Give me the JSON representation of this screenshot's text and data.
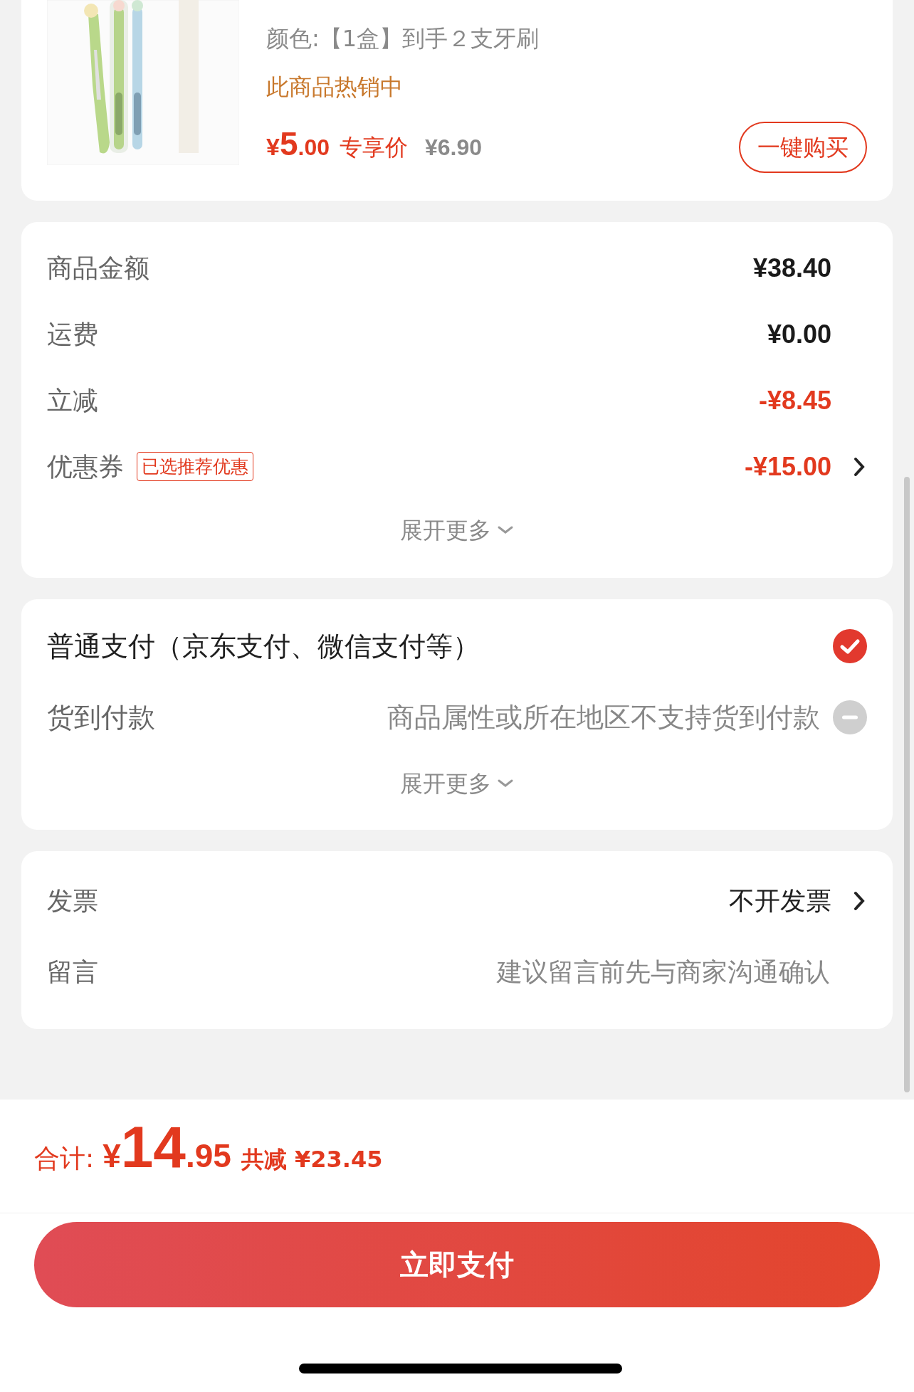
{
  "product": {
    "kind": "picture",
    "spec": "颜色:【1盒】到手２支牙刷",
    "hot_label": "此商品热销中",
    "price_currency": "¥",
    "price_int": "5",
    "price_dec": ".00",
    "price_tag": "专享价",
    "original_price": "¥6.90",
    "buy_button": "一键购买"
  },
  "summary": {
    "rows": [
      {
        "kind": "amount",
        "label": "商品金额",
        "value": "¥38.40"
      },
      {
        "kind": "amount",
        "label": "运费",
        "value": "¥0.00"
      },
      {
        "kind": "discount",
        "label": "立减",
        "value": "-¥8.45"
      },
      {
        "kind": "coupon",
        "label": "优惠券",
        "badge": "已选推荐优惠",
        "value": "-¥15.00"
      }
    ],
    "expand": "展开更多"
  },
  "payment": {
    "options": [
      {
        "label": "普通支付（京东支付、微信支付等）",
        "selected": true,
        "disabled": false
      },
      {
        "label": "货到付款",
        "note": "商品属性或所在地区不支持货到付款",
        "selected": false,
        "disabled": true
      }
    ],
    "expand": "展开更多"
  },
  "extras": [
    {
      "kind": "link",
      "label": "发票",
      "value": "不开发票"
    },
    {
      "kind": "input",
      "label": "留言",
      "placeholder": "建议留言前先与商家沟通确认"
    }
  ],
  "footer": {
    "total_label": "合计:",
    "currency": "¥",
    "total_int": "14",
    "total_dec": ".95",
    "saved": "共减 ¥23.45",
    "pay_button": "立即支付"
  }
}
